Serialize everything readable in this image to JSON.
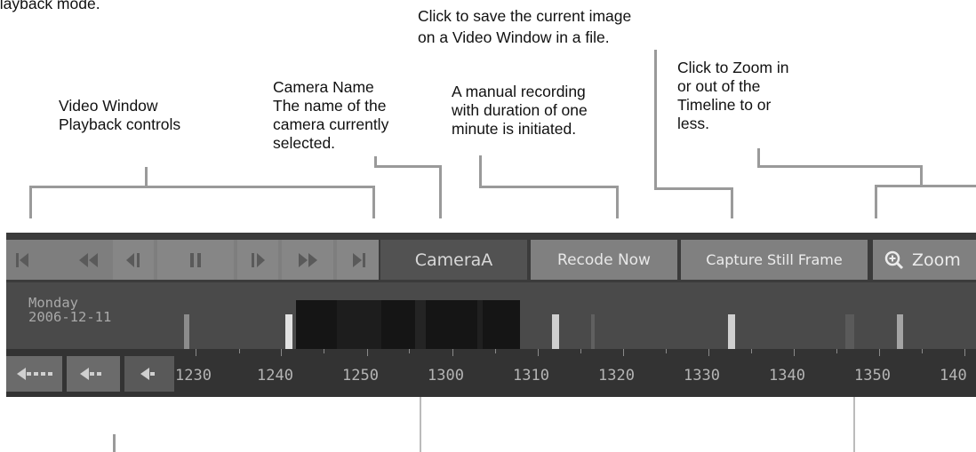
{
  "intro_fragment": "playback mode.",
  "callouts": {
    "capture_line1": "Click to save the current image",
    "capture_line2": "on a Video Window in a file.",
    "zoom_line1": "Click to Zoom in",
    "zoom_line2": "or out of the",
    "zoom_line3": "Timeline to or",
    "zoom_line4": "less.",
    "playback_line1": "Video Window",
    "playback_line2": "Playback controls",
    "camera_line1": "Camera Name",
    "camera_line2": "The name of the",
    "camera_line3": "camera currently",
    "camera_line4": "selected.",
    "record_line1": "A manual recording",
    "record_line2": "with duration of one",
    "record_line3": "minute is initiated."
  },
  "toolbar": {
    "camera_name": "CameraA",
    "record_now_label": "Recode Now",
    "capture_label": "Capture Still Frame",
    "zoom_label": "Zoom",
    "playback_buttons": [
      {
        "name": "skip-to-start-icon"
      },
      {
        "name": "fast-rewind-icon"
      },
      {
        "name": "step-back-icon"
      },
      {
        "name": "pause-icon"
      },
      {
        "name": "step-forward-icon"
      },
      {
        "name": "fast-forward-icon"
      },
      {
        "name": "skip-to-end-icon"
      }
    ]
  },
  "timeline": {
    "day": "Monday",
    "date": "2006-12-11",
    "tick_labels": [
      "1230",
      "1240",
      "1250",
      "1300",
      "1310",
      "1320",
      "1330",
      "1340",
      "1350",
      "140"
    ]
  },
  "nav_buttons": [
    {
      "name": "scroll-back-far-icon"
    },
    {
      "name": "scroll-back-icon"
    },
    {
      "name": "scroll-back-small-icon"
    }
  ],
  "colors": {
    "toolbar_bg": "#3b3b3b",
    "button_bg": "#808080",
    "timeline_bg": "#4a4a4a",
    "ruler_bg": "#333333",
    "selected_range": "#151515",
    "event_marker": "#e2e2e2",
    "recording_marker": "#8c8c8c"
  }
}
